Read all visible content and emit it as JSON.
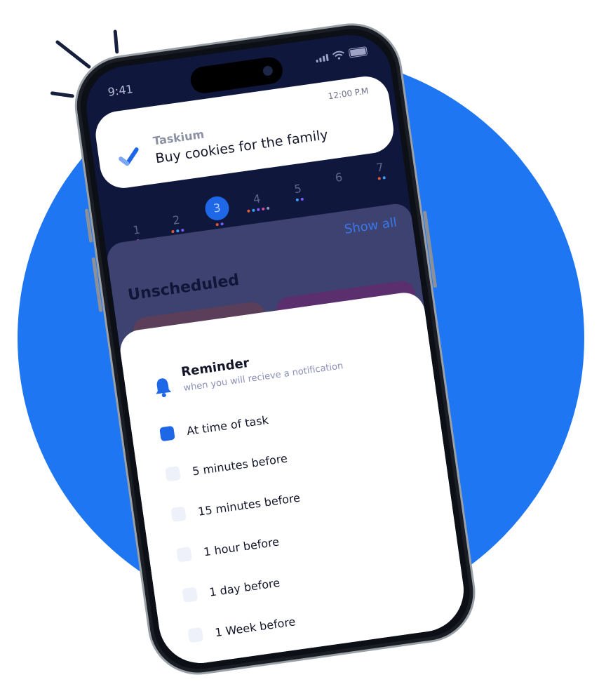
{
  "status_bar": {
    "time": "9:41"
  },
  "notification": {
    "time": "12:00 P.M",
    "app_name": "Taskium",
    "message": "Buy cookies for the family"
  },
  "calendar": {
    "days": [
      {
        "label": "1",
        "dots": [
          "#d84aa2"
        ]
      },
      {
        "label": "2",
        "dots": [
          "#e45a3b",
          "#3aa0ff",
          "#7b5cff"
        ]
      },
      {
        "label": "3",
        "active": true,
        "dots": [
          "#e45a3b",
          "#7b5cff"
        ]
      },
      {
        "label": "4",
        "dots": [
          "#e45a3b",
          "#3aa0ff",
          "#7b5cff",
          "#d84aa2",
          "#8f95b8"
        ]
      },
      {
        "label": "5",
        "dots": [
          "#3aa0ff",
          "#7b5cff"
        ]
      },
      {
        "label": "6",
        "dots": []
      },
      {
        "label": "7",
        "dots": [
          "#e45a3b",
          "#3aa0ff"
        ]
      }
    ]
  },
  "main": {
    "show_all": "Show all",
    "section_title": "Unscheduled"
  },
  "reminder": {
    "title": "Reminder",
    "subtitle": "when you will recieve a notification",
    "options": [
      {
        "label": "At time of task",
        "checked": true
      },
      {
        "label": "5 minutes before",
        "checked": false
      },
      {
        "label": "15 minutes before",
        "checked": false
      },
      {
        "label": "1 hour before",
        "checked": false
      },
      {
        "label": "1 day before",
        "checked": false
      },
      {
        "label": "1 Week before",
        "checked": false
      }
    ]
  },
  "colors": {
    "brand_blue": "#1e76f2",
    "accent": "#1e67e6",
    "screen_bg": "#10173d"
  }
}
